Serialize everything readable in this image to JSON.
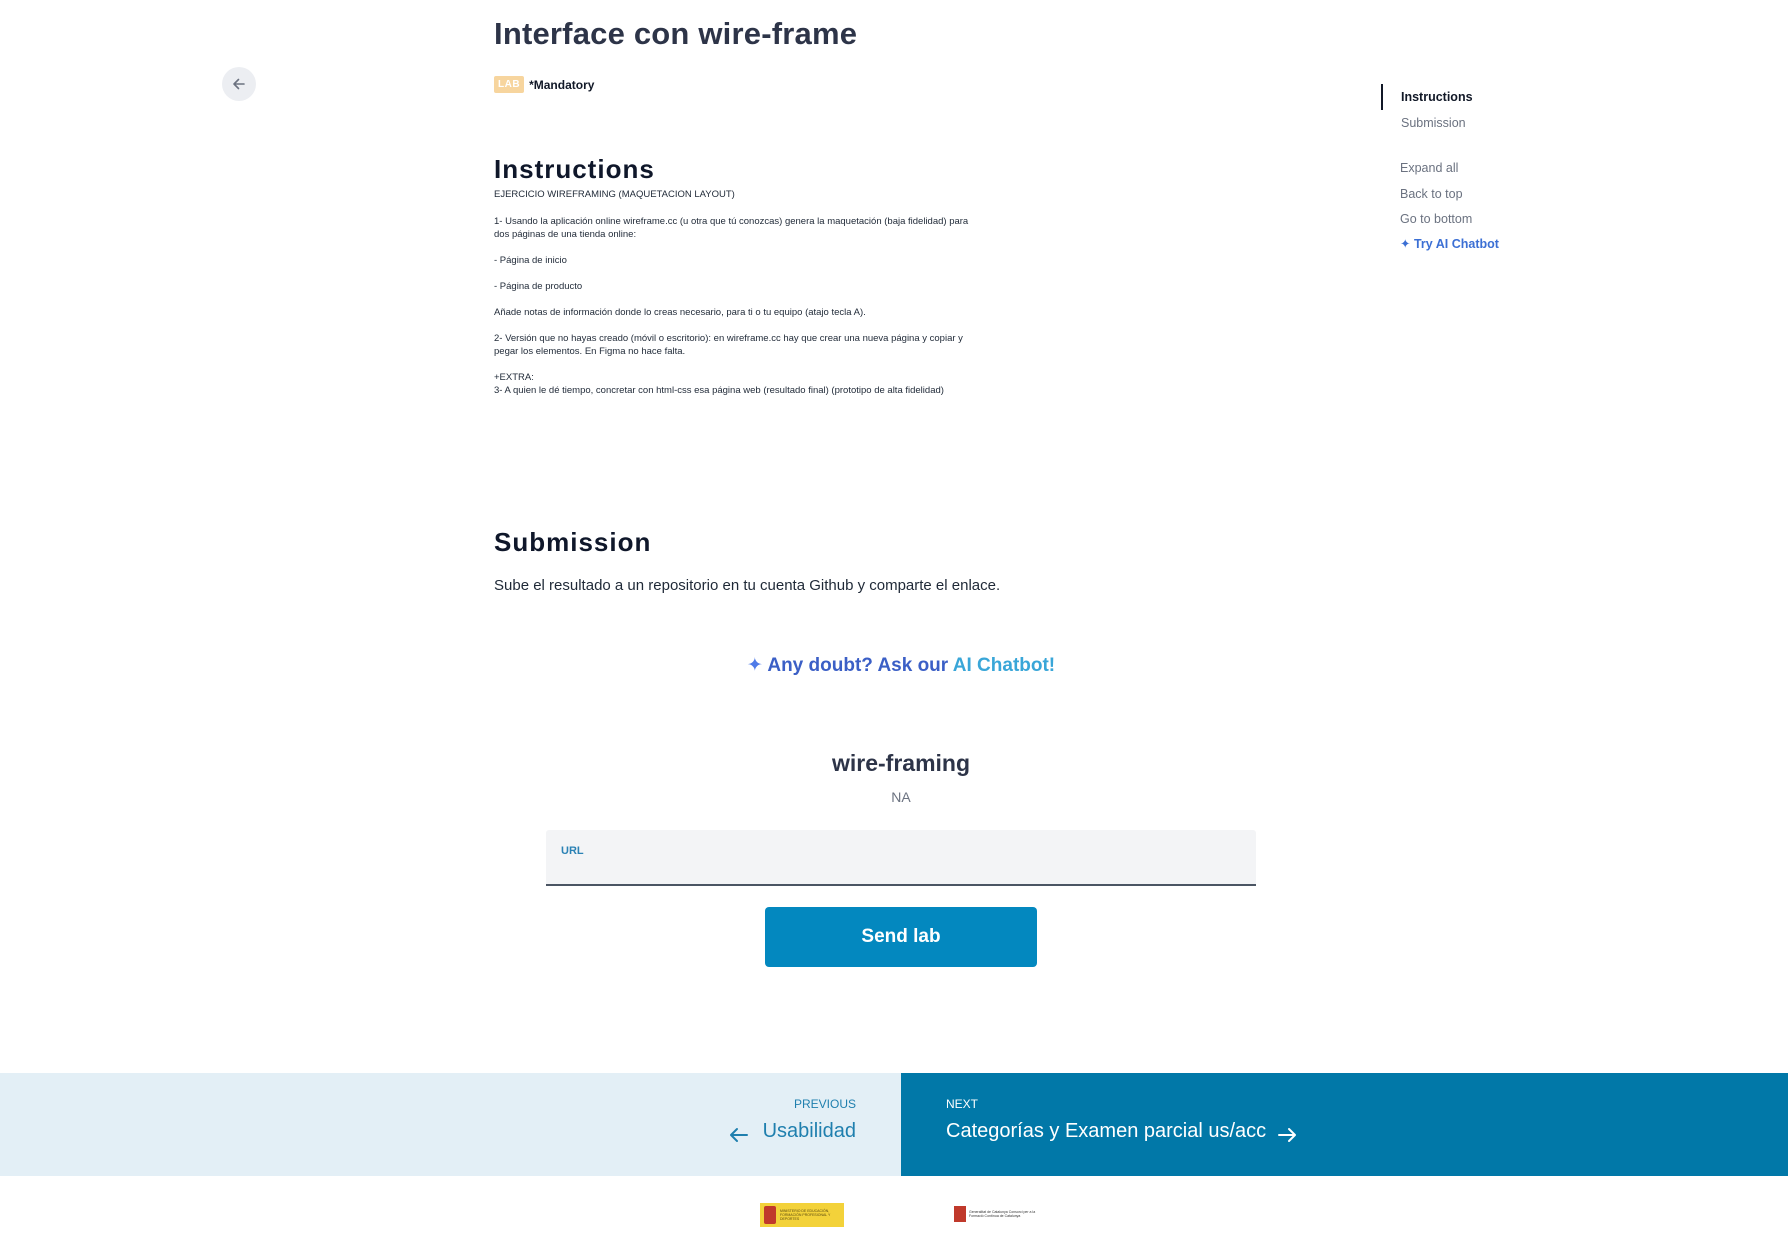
{
  "header": {
    "title": "Interface con wire-frame",
    "lab_tag": "LAB",
    "mandatory": "*Mandatory"
  },
  "instructions": {
    "heading": "Instructions",
    "paragraphs": [
      "EJERCICIO WIREFRAMING (MAQUETACION LAYOUT)",
      "1- Usando la aplicación online wireframe.cc (u otra que tú conozcas) genera la maquetación (baja fidelidad) para dos páginas de una tienda online:",
      "- Página de inicio",
      "- Página de producto",
      "Añade notas de información donde lo creas necesario, para ti o tu equipo (atajo tecla A).",
      "2- Versión que no hayas creado (móvil o escritorio): en wireframe.cc hay que crear una nueva página y copiar y pegar los elementos. En Figma no hace falta.",
      "+EXTRA:",
      "3- A quien le dé tiempo, concretar con html-css esa página web (resultado final) (prototipo de alta fidelidad)"
    ]
  },
  "submission": {
    "heading": "Submission",
    "text": "Sube el resultado a un repositorio en tu cuenta Github y comparte el enlace."
  },
  "ai_prompt": {
    "part1": "Any doubt? Ask our ",
    "part2": "AI Chatbot!"
  },
  "lab_form": {
    "name": "wire-framing",
    "status": "NA",
    "url_label": "URL",
    "url_value": "",
    "submit_label": "Send lab"
  },
  "nav": {
    "previous_kicker": "PREVIOUS",
    "previous_title": "Usabilidad",
    "next_kicker": "NEXT",
    "next_title": "Categorías y Examen parcial us/acc"
  },
  "toc": {
    "items": [
      "Instructions",
      "Submission"
    ],
    "active": "Instructions"
  },
  "side_links": {
    "expand_all": "Expand all",
    "back_to_top": "Back to top",
    "go_to_bottom": "Go to bottom",
    "try_ai": "Try AI Chatbot"
  },
  "footer_logos": {
    "spain": "MINISTERIO DE EDUCACIÓN, FORMACIÓN PROFESIONAL Y DEPORTES",
    "catalonia": "Generalitat de Catalunya Consorci per a la Formació Contínua de Catalunya"
  },
  "colors": {
    "primary_button": "#0388bf",
    "next_nav_bg": "#0178a8",
    "prev_nav_bg": "#e3eff6",
    "lab_tag": "#f7d59e",
    "ai_blue": "#3b5fc6",
    "ai_cyan": "#39a6d8"
  }
}
